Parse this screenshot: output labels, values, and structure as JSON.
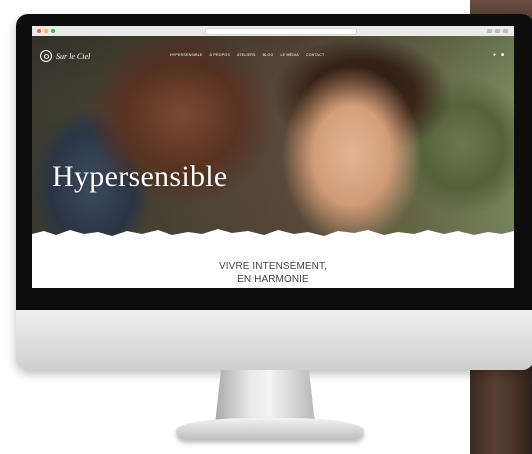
{
  "site": {
    "logo_text": "Sur le Ciel",
    "nav": [
      "HYPERSENSIBLE",
      "À PROPOS",
      "ATELIERS",
      "BLOG",
      "LE MÉDIA",
      "CONTACT"
    ],
    "hero_title": "Hypersensible",
    "tagline_line1": "VIVRE INTENSÉMENT,",
    "tagline_line2": "EN HARMONIE"
  },
  "colors": {
    "hero_text": "#ffffff",
    "tagline": "#444444",
    "bezel": "#0d0d0d",
    "chin": "#d8d8d8"
  }
}
